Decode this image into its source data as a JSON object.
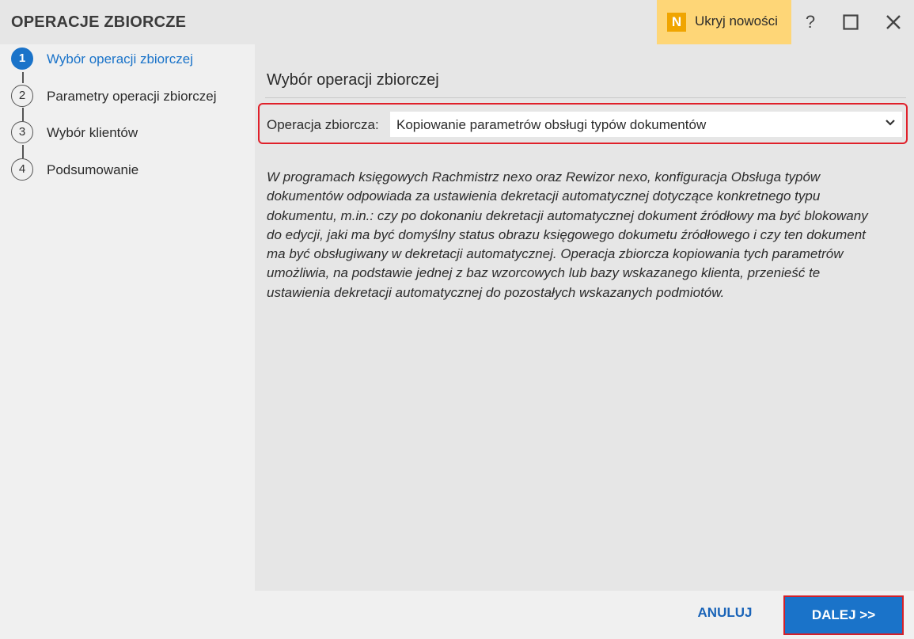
{
  "window": {
    "title": "OPERACJE ZBIORCZE",
    "news_badge": "N",
    "news_label": "Ukryj nowości",
    "help_label": "?"
  },
  "colors": {
    "accent": "#1a73c9",
    "news_bg": "#fed677",
    "badge": "#f0a500",
    "highlight_border": "#e0202a"
  },
  "steps": [
    {
      "number": "1",
      "label": "Wybór operacji zbiorczej",
      "active": true
    },
    {
      "number": "2",
      "label": "Parametry operacji zbiorczej",
      "active": false
    },
    {
      "number": "3",
      "label": "Wybór klientów",
      "active": false
    },
    {
      "number": "4",
      "label": "Podsumowanie",
      "active": false
    }
  ],
  "main": {
    "section_title": "Wybór operacji zbiorczej",
    "operation_label": "Operacja zbiorcza:",
    "operation_value": "Kopiowanie parametrów obsługi typów dokumentów",
    "description_lines": [
      "W programach księgowych Rachmistrz nexo oraz Rewizor nexo, konfiguracja Obsługa typów",
      "dokumentów odpowiada za ustawienia dekretacji automatycznej dotyczące konkretnego typu",
      "dokumentu, m.in.: czy po dokonaniu dekretacji automatycznej dokument źródłowy ma być blokowany",
      "do edycji, jaki ma być domyślny status obrazu księgowego dokumetu źródłowego i czy ten dokument",
      "ma być obsługiwany w dekretacji automatycznej. Operacja zbiorcza kopiowania tych parametrów",
      "umożliwia, na podstawie jednej z baz wzorcowych lub bazy wskazanego klienta, przenieść te",
      "ustawienia dekretacji automatycznej do pozostałych wskazanych podmiotów."
    ]
  },
  "footer": {
    "cancel_label": "ANULUJ",
    "next_label": "DALEJ >>"
  },
  "icons": {
    "maximize": "maximize-icon",
    "close": "close-icon",
    "dropdown": "chevron-down-icon"
  }
}
